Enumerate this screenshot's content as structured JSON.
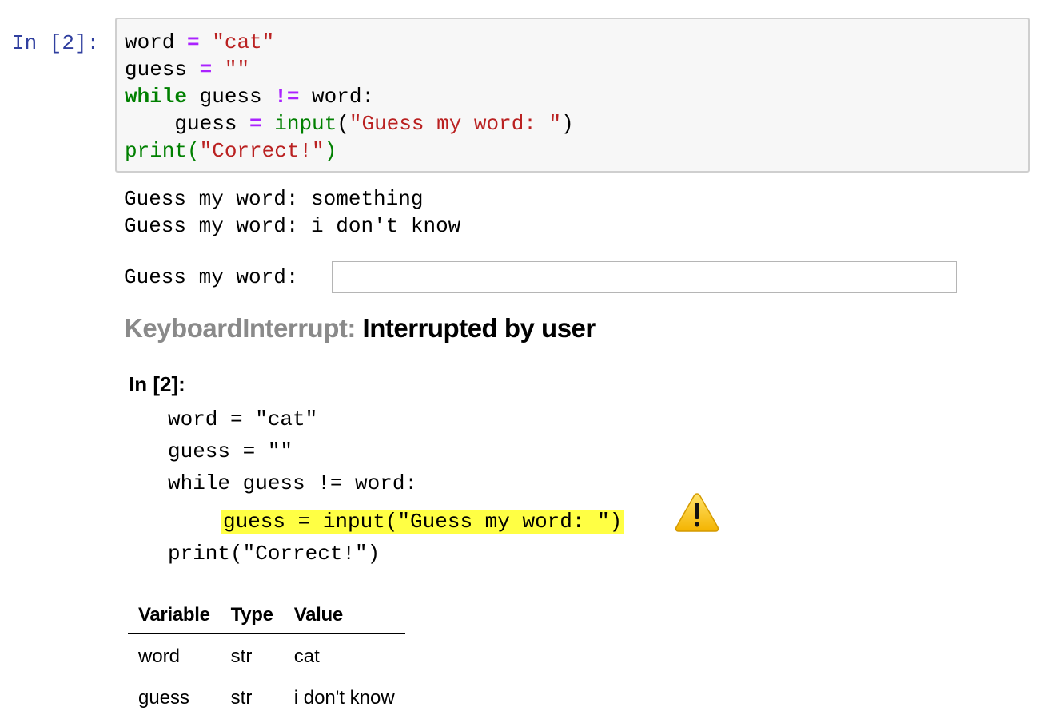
{
  "cell": {
    "prompt": "In [2]:",
    "code": {
      "l1": {
        "a": "word ",
        "op": "=",
        "b": " ",
        "s": "\"cat\""
      },
      "l2": {
        "a": "guess ",
        "op": "=",
        "b": " ",
        "s": "\"\""
      },
      "l3": {
        "kw": "while",
        "a": " guess ",
        "op": "!=",
        "b": " word:"
      },
      "l4": {
        "a": "    guess ",
        "op": "=",
        "b": " ",
        "fn": "input",
        "p1": "(",
        "s": "\"Guess my word: \"",
        "p2": ")"
      },
      "l5": {
        "fn": "print",
        "p1": "(",
        "s": "\"Correct!\"",
        "p2": ")"
      }
    }
  },
  "output": {
    "stdout_lines": [
      "Guess my word: something",
      "Guess my word: i don't know"
    ],
    "stdin_prompt": "Guess my word:",
    "stdin_value": ""
  },
  "error": {
    "name": "KeyboardInterrupt:",
    "message": "Interrupted by user"
  },
  "traceback": {
    "header": "In [2]:",
    "lines": [
      "word = \"cat\"",
      "guess = \"\"",
      "while guess != word:",
      "    guess = input(\"Guess my word: \")",
      "print(\"Correct!\")"
    ],
    "highlight_line_text": "guess = input(\"Guess my word: \")",
    "warning_icon": "warning-triangle-icon",
    "highlight_color": "#ffff44"
  },
  "variables": {
    "headers": [
      "Variable",
      "Type",
      "Value"
    ],
    "rows": [
      [
        "word",
        "str",
        "cat"
      ],
      [
        "guess",
        "str",
        "i don't know"
      ]
    ]
  }
}
